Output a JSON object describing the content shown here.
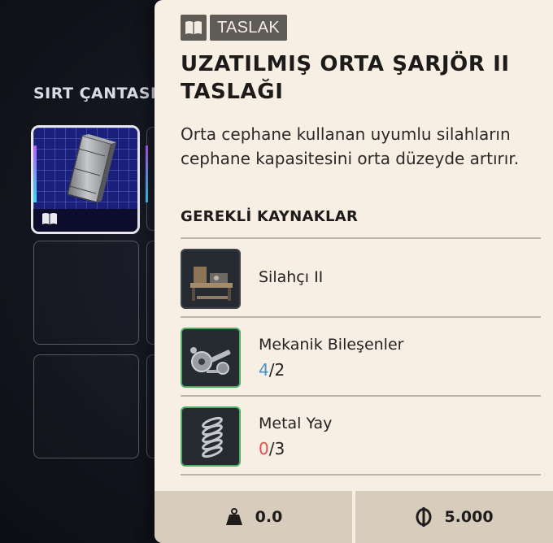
{
  "backpack": {
    "title": "SIRT ÇANTASI",
    "slots": [
      {
        "item": "blueprint-magazine",
        "selected": true
      },
      {
        "item": null
      },
      {
        "item": null
      },
      {
        "item": null
      },
      {
        "item": null
      },
      {
        "item": null
      }
    ]
  },
  "tooltip": {
    "tag": {
      "icon": "book-icon",
      "label": "TASLAK"
    },
    "title": "UZATILMIŞ ORTA ŞARJÖR II TASLAĞI",
    "description": "Orta cephane kullanan uyumlu silahların cephane kapasitesini orta düzeyde artırır.",
    "requirements_title": "GEREKLİ KAYNAKLAR",
    "requirements": [
      {
        "name": "Silahçı II",
        "icon": "workbench-icon"
      },
      {
        "name": "Mekanik Bileşenler",
        "icon": "mechanical-parts-icon",
        "have": "4",
        "sep": "/",
        "need": "2",
        "status": "ok"
      },
      {
        "name": "Metal Yay",
        "icon": "metal-spring-icon",
        "have": "0",
        "sep": "/",
        "need": "3",
        "status": "insufficient"
      }
    ],
    "footer": {
      "weight": {
        "icon": "weight-icon",
        "value": "0.0"
      },
      "price": {
        "icon": "coin-icon",
        "value": "5.000"
      }
    }
  },
  "colors": {
    "panel_bg": "#f8efe4",
    "tag_bg": "#5f5b56",
    "count_ok": "#4a93c9",
    "count_bad": "#e0504c",
    "footer_bg": "#d8ccbc",
    "item_bg": "#1a1f7a"
  }
}
